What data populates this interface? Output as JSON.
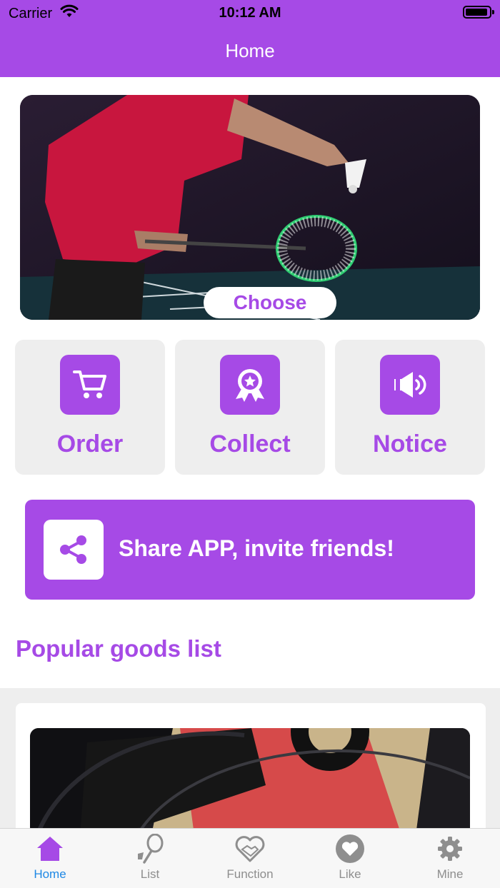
{
  "status_bar": {
    "carrier": "Carrier",
    "time": "10:12 AM"
  },
  "header": {
    "title": "Home"
  },
  "banner": {
    "choose_label": "Choose"
  },
  "quick_actions": [
    {
      "label": "Order",
      "icon": "cart-icon"
    },
    {
      "label": "Collect",
      "icon": "award-badge-icon"
    },
    {
      "label": "Notice",
      "icon": "megaphone-icon"
    }
  ],
  "share": {
    "label": "Share APP, invite friends!",
    "icon": "share-icon"
  },
  "popular": {
    "title": "Popular goods list"
  },
  "tabs": [
    {
      "label": "Home",
      "icon": "home-icon",
      "active": true
    },
    {
      "label": "List",
      "icon": "racket-icon",
      "active": false
    },
    {
      "label": "Function",
      "icon": "heart-handshake-icon",
      "active": false
    },
    {
      "label": "Like",
      "icon": "heart-icon",
      "active": false
    },
    {
      "label": "Mine",
      "icon": "gear-icon",
      "active": false
    }
  ],
  "colors": {
    "accent": "#a64ae6",
    "active_tab": "#1e88e5",
    "tile_bg": "#eeeeee"
  }
}
